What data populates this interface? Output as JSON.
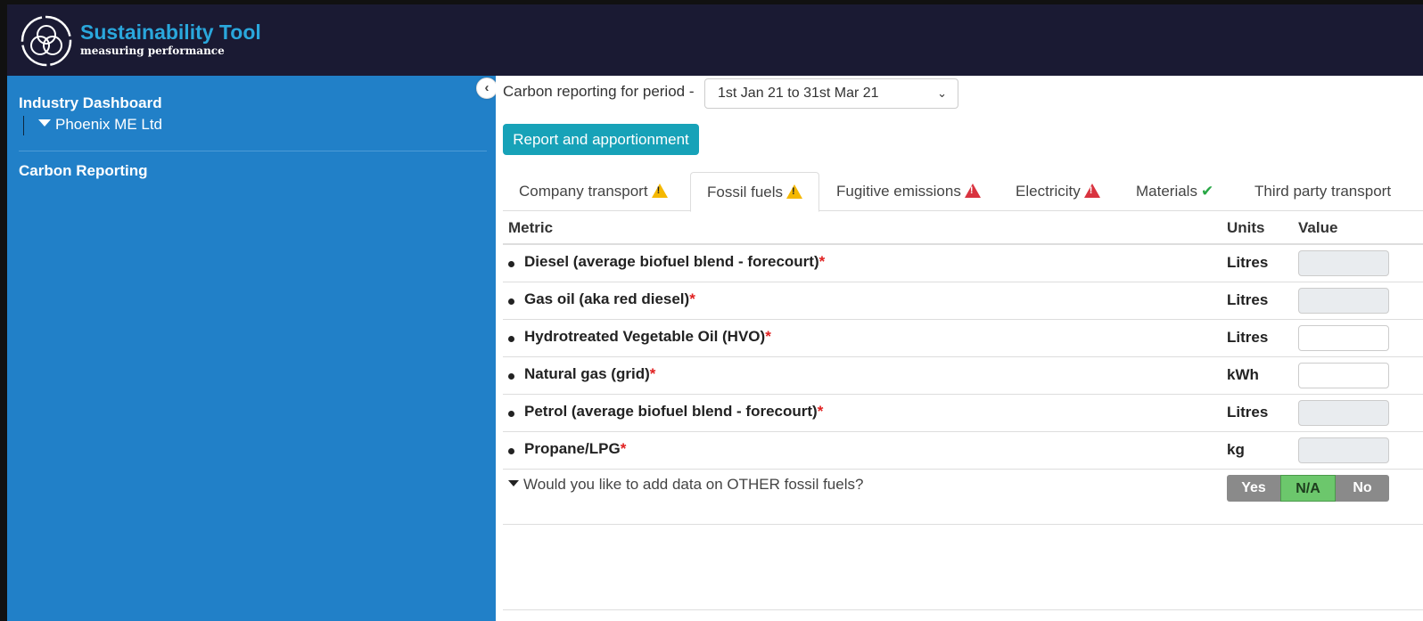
{
  "brand": {
    "title": "Sustainability Tool",
    "subtitle": "measuring performance",
    "accent": "#2aa7dc",
    "header_bg": "#1a1a33"
  },
  "sidebar": {
    "bg": "#2180c8",
    "heading": "Industry Dashboard",
    "org": "Phoenix ME Ltd",
    "section": "Carbon Reporting"
  },
  "period": {
    "label": "Carbon reporting for period -",
    "selected": "1st Jan 21 to 31st Mar 21"
  },
  "report_button": "Report and apportionment",
  "tabs": [
    {
      "label": "Company transport",
      "status": "warning-icon",
      "active": false
    },
    {
      "label": "Fossil fuels",
      "status": "warning-icon",
      "active": true
    },
    {
      "label": "Fugitive emissions",
      "status": "error-icon",
      "active": false
    },
    {
      "label": "Electricity",
      "status": "error-icon",
      "active": false
    },
    {
      "label": "Materials",
      "status": "check-icon",
      "active": false
    },
    {
      "label": "Third party transport",
      "status": "",
      "active": false
    }
  ],
  "table": {
    "headers": {
      "metric": "Metric",
      "units": "Units",
      "value": "Value"
    },
    "required_marker": "*",
    "rows": [
      {
        "metric": "Diesel (average biofuel blend - forecourt)",
        "unit": "Litres",
        "value": "",
        "enabled": false
      },
      {
        "metric": "Gas oil (aka red diesel)",
        "unit": "Litres",
        "value": "",
        "enabled": false
      },
      {
        "metric": "Hydrotreated Vegetable Oil (HVO)",
        "unit": "Litres",
        "value": "",
        "enabled": true
      },
      {
        "metric": "Natural gas (grid)",
        "unit": "kWh",
        "value": "",
        "enabled": true
      },
      {
        "metric": "Petrol (average biofuel blend - forecourt)",
        "unit": "Litres",
        "value": "",
        "enabled": false
      },
      {
        "metric": "Propane/LPG",
        "unit": "kg",
        "value": "",
        "enabled": false
      }
    ]
  },
  "other": {
    "question": "Would you like to add data on OTHER fossil fuels?",
    "options": [
      "Yes",
      "N/A",
      "No"
    ],
    "selected": "N/A"
  }
}
